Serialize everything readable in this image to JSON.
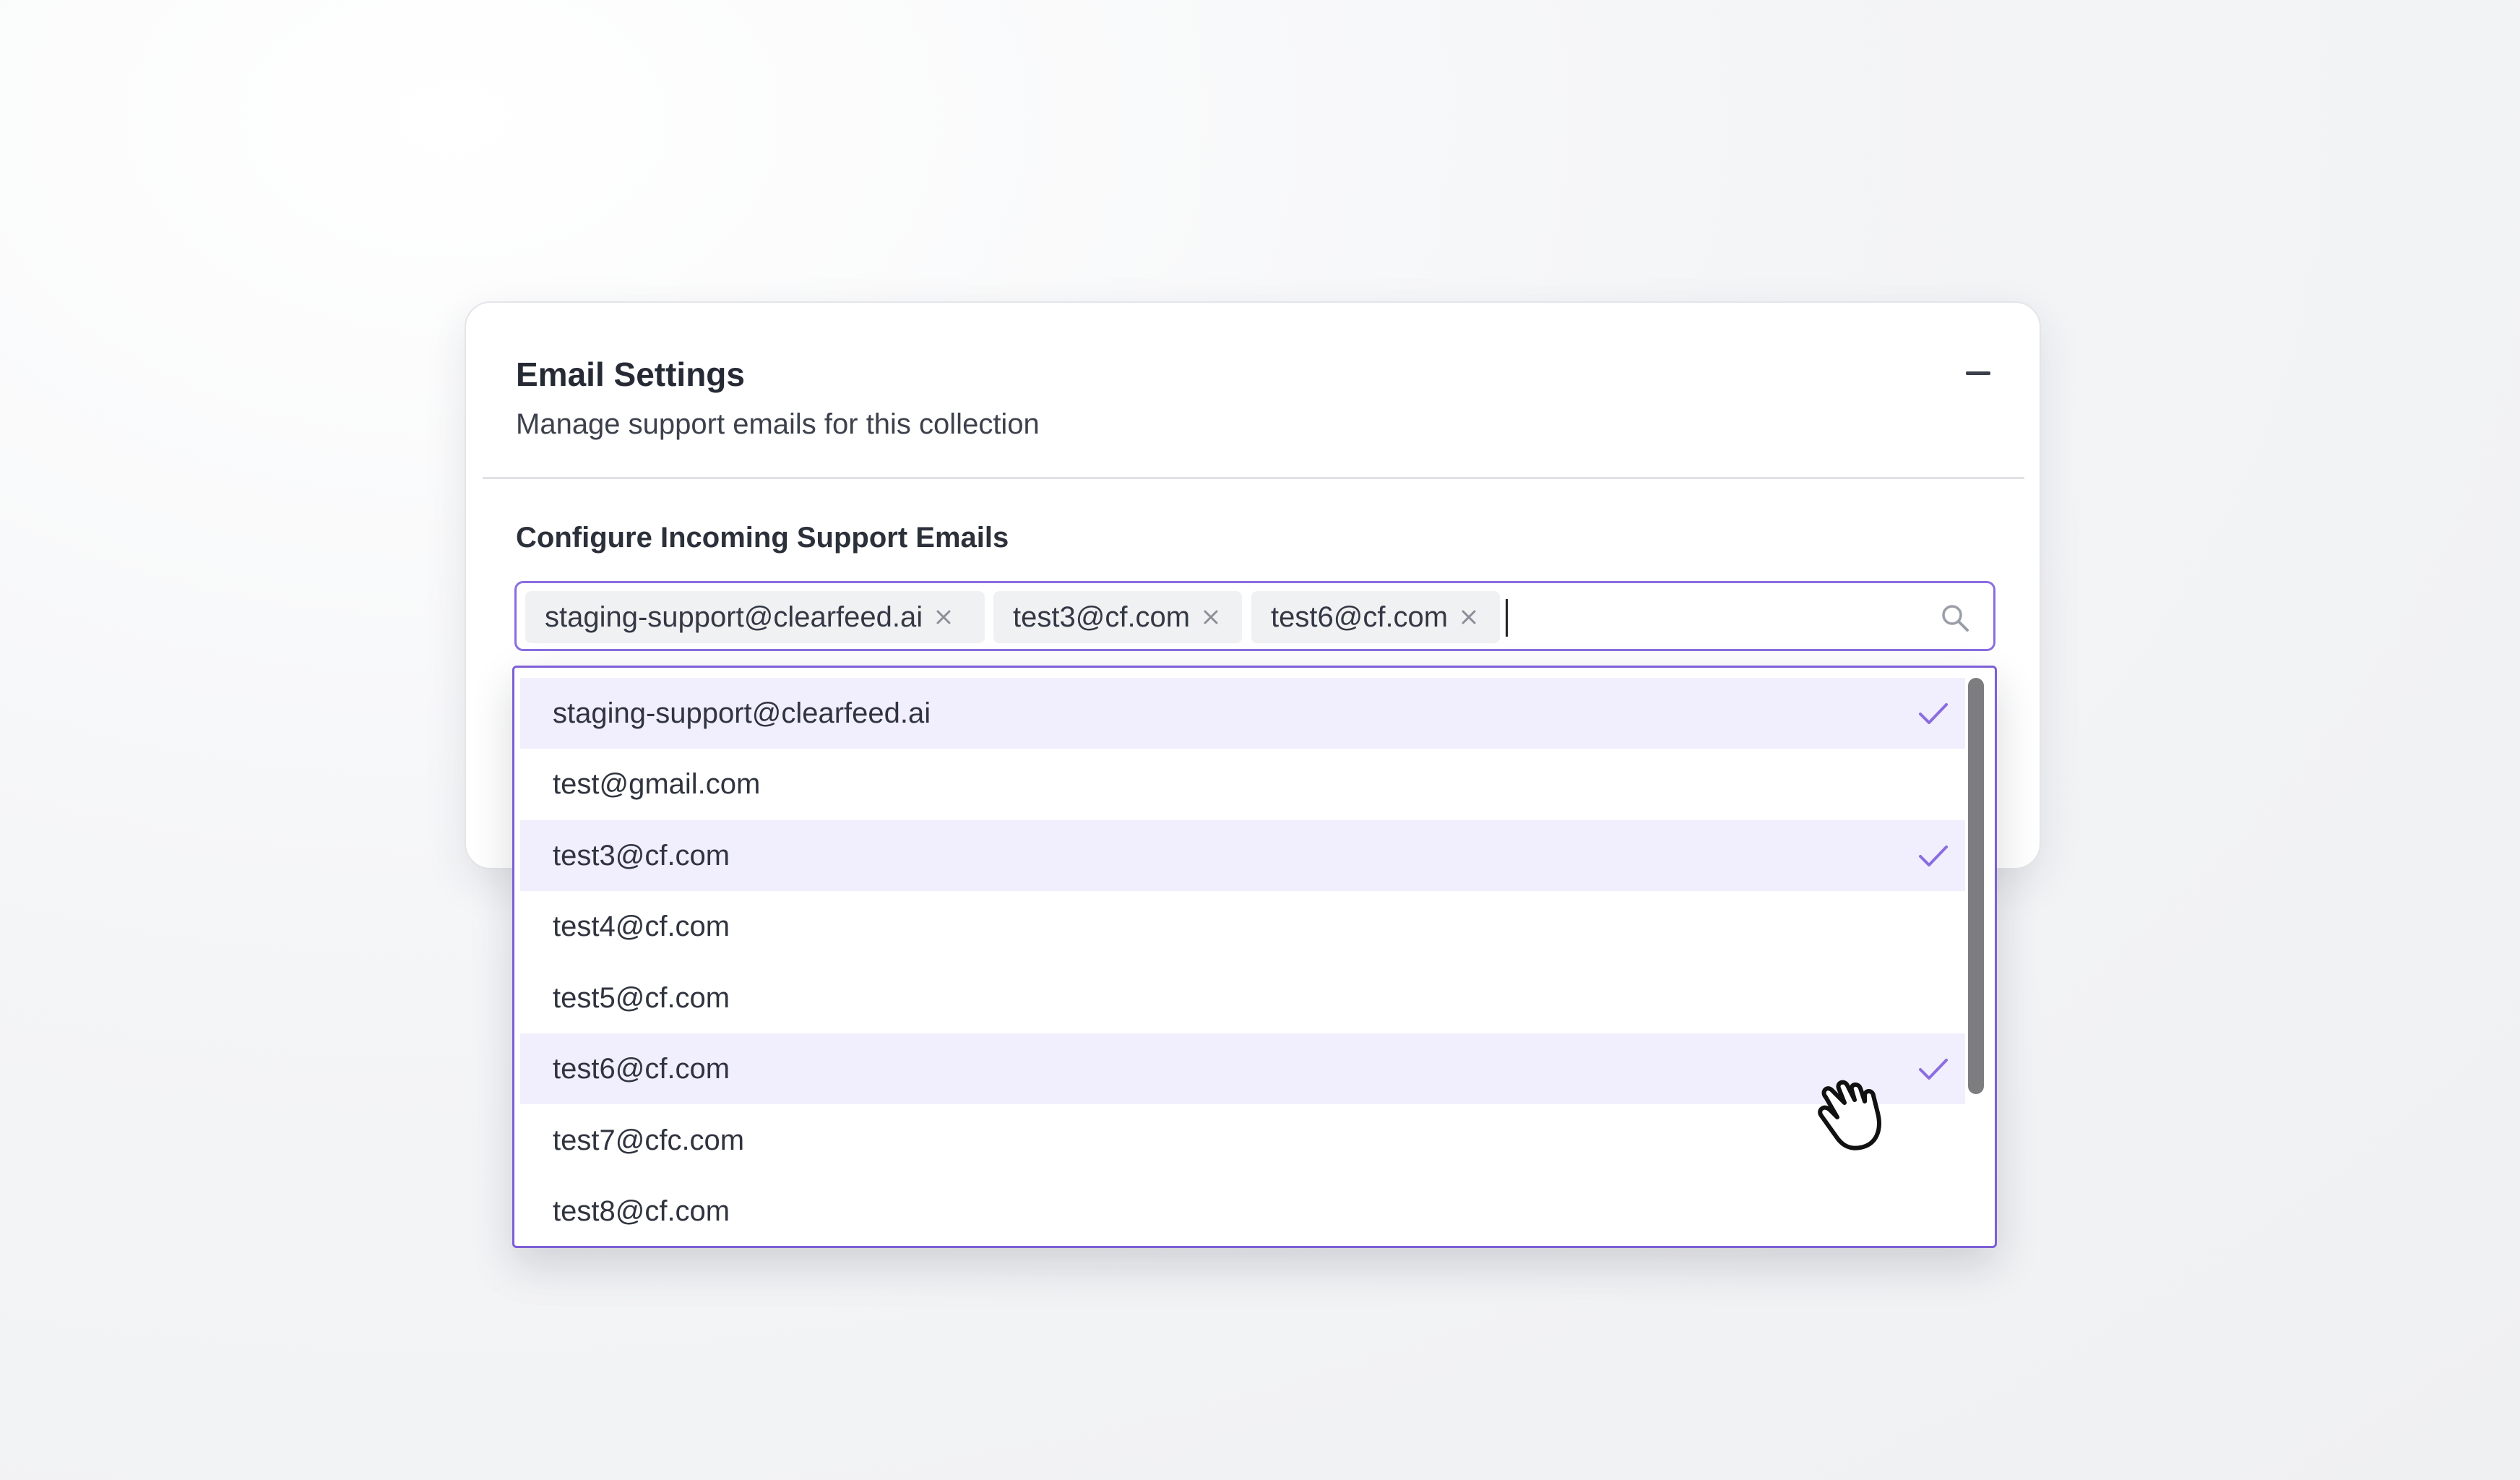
{
  "panel": {
    "title": "Email Settings",
    "subtitle": "Manage support emails for this collection",
    "collapse_icon": "minus-icon"
  },
  "field": {
    "label": "Configure Incoming Support Emails",
    "tags": [
      {
        "label": "staging-support@clearfeed.ai"
      },
      {
        "label": "test3@cf.com"
      },
      {
        "label": "test6@cf.com"
      }
    ],
    "search_icon": "search-icon"
  },
  "dropdown": {
    "options": [
      {
        "label": "staging-support@clearfeed.ai",
        "selected": true
      },
      {
        "label": "test@gmail.com",
        "selected": false
      },
      {
        "label": "test3@cf.com",
        "selected": true
      },
      {
        "label": "test4@cf.com",
        "selected": false
      },
      {
        "label": "test5@cf.com",
        "selected": false
      },
      {
        "label": "test6@cf.com",
        "selected": true
      },
      {
        "label": "test7@cfc.com",
        "selected": false
      },
      {
        "label": "test8@cf.com",
        "selected": false
      }
    ]
  },
  "colors": {
    "accent": "#7d5fd6",
    "selected_row": "#f1eefd",
    "check": "#8a6de0"
  }
}
